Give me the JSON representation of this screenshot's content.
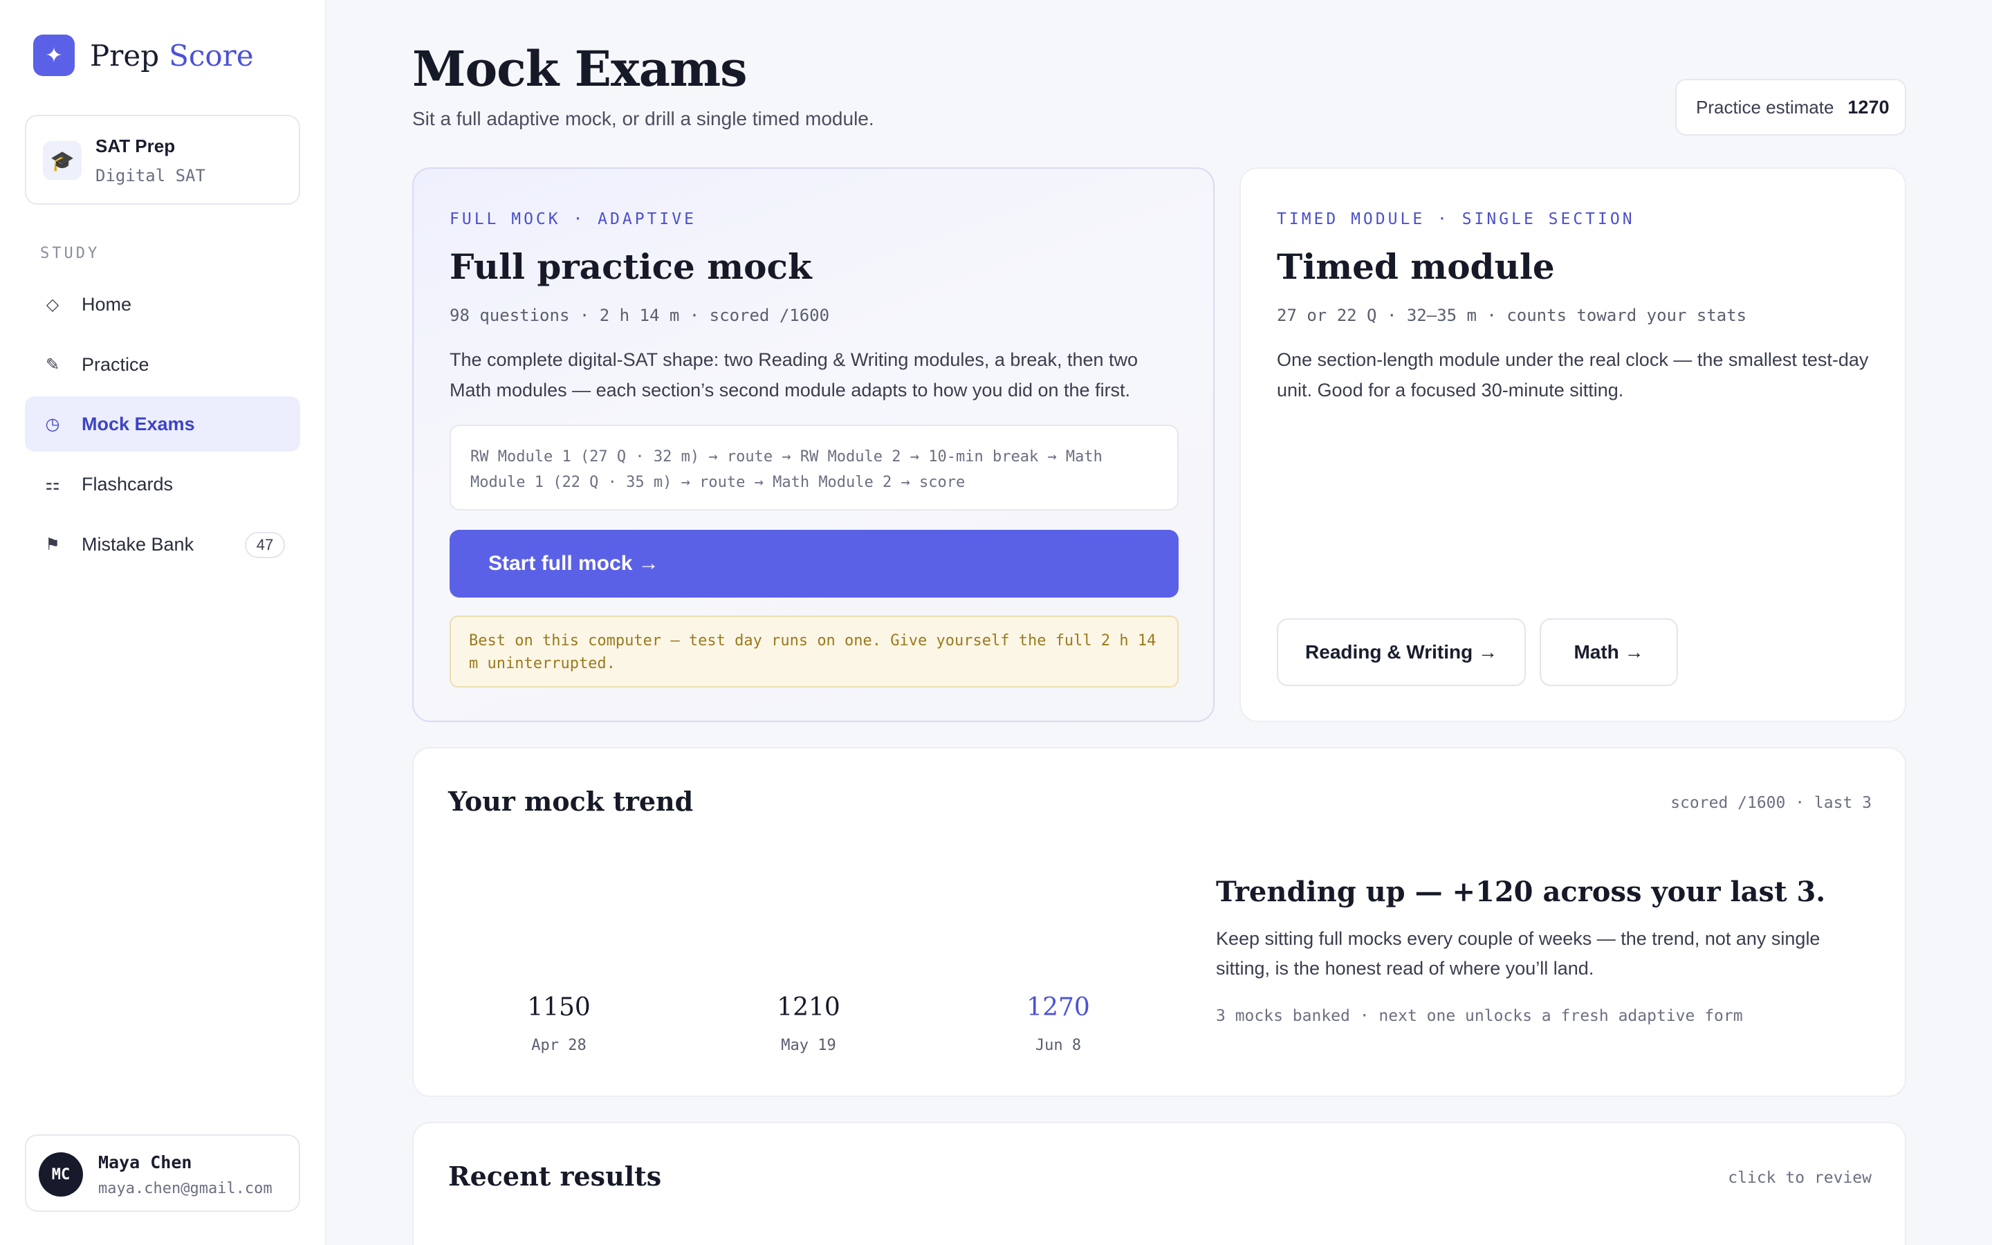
{
  "brand": {
    "icon": "sparkle-icon",
    "name_part1": "Prep",
    "name_part2": "Score"
  },
  "course": {
    "icon": "graduation-cap-icon",
    "name": "SAT Prep",
    "subtitle": "Digital SAT"
  },
  "sidebar": {
    "section_label": "STUDY",
    "items": [
      {
        "label": "Home",
        "icon": "diamond-icon",
        "glyph": "◇",
        "active": false
      },
      {
        "label": "Practice",
        "icon": "pencil-icon",
        "glyph": "✎",
        "active": false
      },
      {
        "label": "Mock Exams",
        "icon": "clock-icon",
        "glyph": "◷",
        "active": true
      },
      {
        "label": "Flashcards",
        "icon": "cards-icon",
        "glyph": "⚏",
        "active": false
      },
      {
        "label": "Mistake Bank",
        "icon": "flag-icon",
        "glyph": "⚑",
        "active": false,
        "badge": "47"
      }
    ]
  },
  "user": {
    "initials": "MC",
    "name": "Maya Chen",
    "email": "maya.chen@gmail.com"
  },
  "header": {
    "title": "Mock Exams",
    "subtitle": "Sit a full adaptive mock, or drill a single timed module.",
    "estimate_label": "Practice estimate",
    "estimate_value": "1270"
  },
  "full_mock": {
    "eyebrow": "FULL MOCK · ADAPTIVE",
    "title": "Full practice mock",
    "meta": "98 questions · 2 h 14 m · scored /1600",
    "description": "The complete digital-SAT shape: two Reading & Writing modules, a break, then two Math modules — each section’s second module adapts to how you did on the first.",
    "flow": "RW Module 1 (27 Q · 32 m) → route → RW Module 2 → 10-min break → Math Module 1 (22 Q · 35 m) → route → Math Module 2 → score",
    "start_label": "Start full mock →",
    "note": "Best on this computer — test day runs on one. Give yourself the full 2 h 14 m uninterrupted."
  },
  "timed_module": {
    "eyebrow": "TIMED MODULE · SINGLE SECTION",
    "title": "Timed module",
    "meta": "27 or 22 Q · 32–35 m · counts toward your stats",
    "description": "One section-length module under the real clock — the smallest test-day unit. Good for a focused 30-minute sitting.",
    "rw_label": "Reading & Writing →",
    "math_label": "Math →"
  },
  "trend": {
    "title": "Your mock trend",
    "meta": "scored /1600 · last 3",
    "points": [
      {
        "score": "1150",
        "date": "Apr 28"
      },
      {
        "score": "1210",
        "date": "May 19"
      },
      {
        "score": "1270",
        "date": "Jun 8"
      }
    ],
    "headline": "Trending up — +120 across your last 3.",
    "description": "Keep sitting full mocks every couple of weeks — the trend, not any single sitting, is the honest read of where you’ll land.",
    "footnote": "3 mocks banked · next one unlocks a fresh adaptive form"
  },
  "results": {
    "title": "Recent results",
    "meta": "click to review"
  },
  "colors": {
    "accent": "#5b61e6",
    "accent_text": "#4b51d8",
    "note_bg": "#fbf6e6",
    "note_text": "#9a7a1c"
  }
}
